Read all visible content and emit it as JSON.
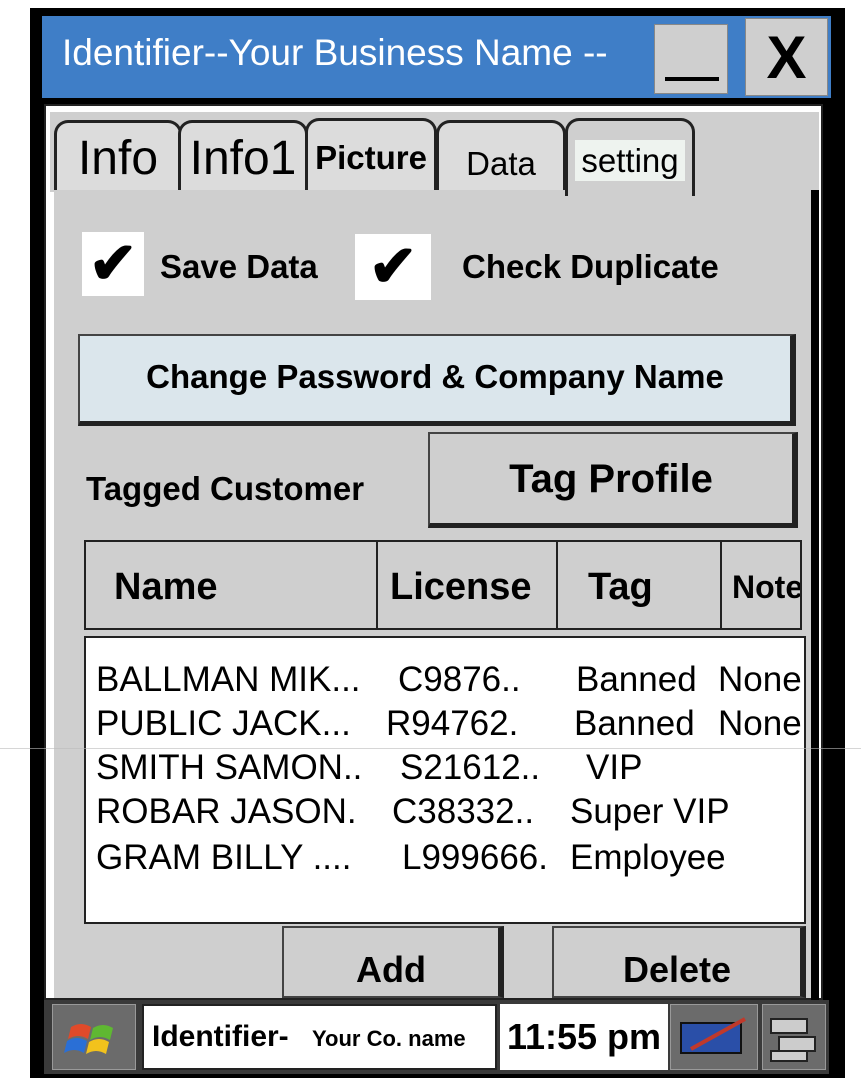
{
  "window": {
    "title": "Identifier--Your Business Name --",
    "minimize_icon": "minimize-icon",
    "close_label": "X"
  },
  "tabs": [
    {
      "label": "Info"
    },
    {
      "label": "Info1"
    },
    {
      "label": "Picture"
    },
    {
      "label": "Data"
    },
    {
      "label": "setting",
      "active": true
    }
  ],
  "settings": {
    "save_data": {
      "label": "Save Data",
      "checked": true
    },
    "check_duplicate": {
      "label": "Check Duplicate",
      "checked": true
    },
    "change_password_button": "Change Password & Company Name",
    "tagged_customer_label": "Tagged Customer",
    "tag_profile_button": "Tag Profile"
  },
  "table": {
    "columns": [
      "Name",
      "License",
      "Tag",
      "Note"
    ],
    "rows": [
      {
        "name": "BALLMAN MIK...",
        "license": "C9876..",
        "tag": "Banned",
        "note": "None"
      },
      {
        "name": "PUBLIC JACK...",
        "license": "R94762.",
        "tag": "Banned",
        "note": "None"
      },
      {
        "name": "SMITH SAMON..",
        "license": "S21612..",
        "tag": "VIP",
        "note": ""
      },
      {
        "name": "ROBAR JASON.",
        "license": "C38332..",
        "tag": "Super VIP",
        "note": ""
      },
      {
        "name": "GRAM BILLY ....",
        "license": "L999666.",
        "tag": "Employee",
        "note": ""
      }
    ]
  },
  "actions": {
    "add": "Add",
    "delete": "Delete"
  },
  "taskbar": {
    "start_icon": "windows-logo-icon",
    "app_name_main": "Identifier-",
    "app_name_sub": "Your Co. name",
    "clock": "11:55 pm",
    "tray_icons": [
      "input-panel-icon",
      "task-switch-icon"
    ]
  },
  "colors": {
    "titlebar": "#3f7ec7",
    "panel": "#cfcfcf",
    "button_light_blue": "#dbe6ec"
  }
}
